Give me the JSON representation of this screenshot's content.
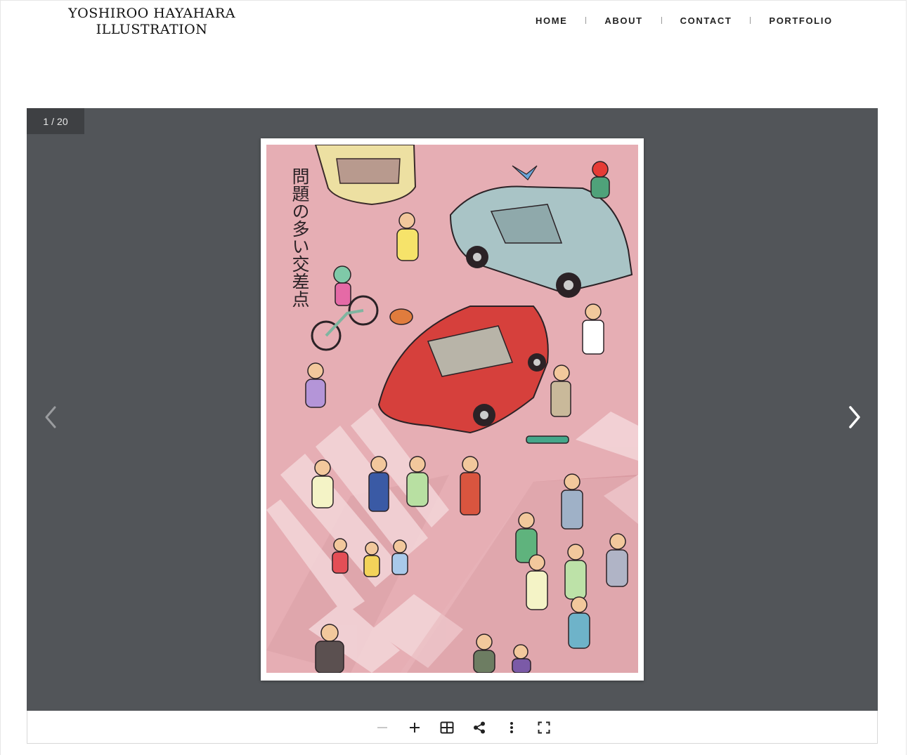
{
  "site": {
    "logo_line1": "YOSHIROO HAYAHARA",
    "logo_line2": "ILLUSTRATION"
  },
  "nav": {
    "items": [
      {
        "label": "HOME"
      },
      {
        "label": "ABOUT"
      },
      {
        "label": "CONTACT"
      },
      {
        "label": "PORTFOLIO"
      }
    ]
  },
  "gallery": {
    "current": "1",
    "separator": "/",
    "total": "20",
    "image_title": "問題の多い交差点",
    "background_color": "#525559",
    "prev_icon": "chevron-left-icon",
    "next_icon": "chevron-right-icon"
  },
  "toolbar": {
    "icons": [
      "zoom-out-icon",
      "zoom-in-icon",
      "grid-icon",
      "share-icon",
      "more-vertical-icon",
      "fullscreen-icon"
    ]
  }
}
